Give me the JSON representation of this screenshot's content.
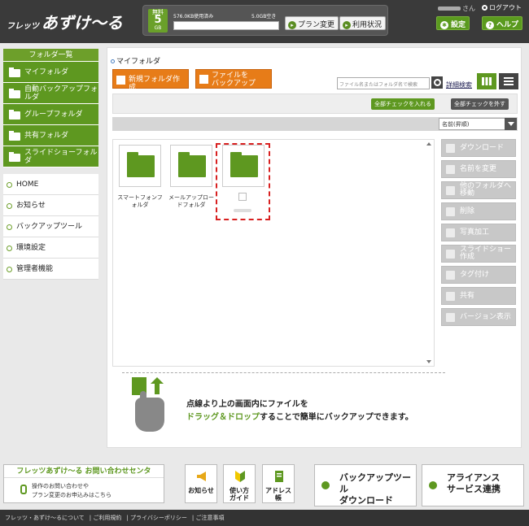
{
  "header": {
    "logo_small": "フレッツ",
    "logo_large": "あずけ〜る",
    "plan": {
      "free_label": "無料",
      "gb_value": "5",
      "gb_unit": "GB",
      "used_text": "576.0KB使用済み",
      "free_text": "5.0GB空き",
      "usage_fraction": 0.0001
    },
    "plan_change_label": "プラン変更",
    "usage_status_label": "利用状況",
    "user_suffix": "さん",
    "logout_label": "ログアウト",
    "settings_label": "設定",
    "help_label": "ヘルプ"
  },
  "sidebar": {
    "folders_header": "フォルダ一覧",
    "folders": [
      {
        "label": "マイフォルダ"
      },
      {
        "label": "自動バックアップフォルダ"
      },
      {
        "label": "グループフォルダ"
      },
      {
        "label": "共有フォルダ"
      },
      {
        "label": "スライドショーフォルダ"
      }
    ],
    "nav": [
      {
        "label": "HOME"
      },
      {
        "label": "お知らせ"
      },
      {
        "label": "バックアップツール"
      },
      {
        "label": "環境設定"
      },
      {
        "label": "管理者機能"
      }
    ]
  },
  "main": {
    "breadcrumb": "マイフォルダ",
    "new_folder_label": "新規フォルダ作成",
    "file_backup_label_1": "ファイルを",
    "file_backup_label_2": "バックアップ",
    "search_placeholder": "ファイル名またはフォルダ名で検索",
    "advanced_search_label": "詳細検索",
    "check_all_label": "全部チェックを入れる",
    "uncheck_all_label": "全部チェックを外す",
    "sort_selected": "名前(昇順)",
    "folders": [
      {
        "label": "スマートフォンフォルダ"
      },
      {
        "label": "メールアップロードフォルダ"
      }
    ],
    "tools": [
      {
        "label": "ダウンロード"
      },
      {
        "label": "名前を変更"
      },
      {
        "label": "他のフォルダへ移動"
      },
      {
        "label": "削除"
      },
      {
        "label": "写真加工"
      },
      {
        "label": "スライドショー作成"
      },
      {
        "label": "タグ付け"
      },
      {
        "label": "共有"
      },
      {
        "label": "バージョン表示"
      }
    ],
    "drop_line1": "点線より上の画面内にファイルを",
    "drop_line2_green": "ドラッグ＆ドロップ",
    "drop_line2_rest": "することで簡単にバックアップできます。"
  },
  "bottom": {
    "contact_title": "フレッツあずけ〜る お問い合わせセンタ",
    "contact_sub1": "操作のお問い合わせや",
    "contact_sub2": "プラン変更のお申込みはこちら",
    "news_label": "お知らせ",
    "guide_label1": "使い方",
    "guide_label2": "ガイド",
    "address_label1": "アドレス",
    "address_label2": "帳",
    "backup_tool_label1": "バックアップツール",
    "backup_tool_label2": "ダウンロード",
    "alliance_label1": "アライアンス",
    "alliance_label2": "サービス連携"
  },
  "footer": {
    "links": [
      "フレッツ・あずけ〜るについて",
      "ご利用規約",
      "プライバシーポリシー",
      "ご注意事項"
    ]
  },
  "colors": {
    "header": "#3a3a3a",
    "brand_green": "#5e9820",
    "orange": "#e77c18",
    "highlight_red": "#d82020"
  }
}
